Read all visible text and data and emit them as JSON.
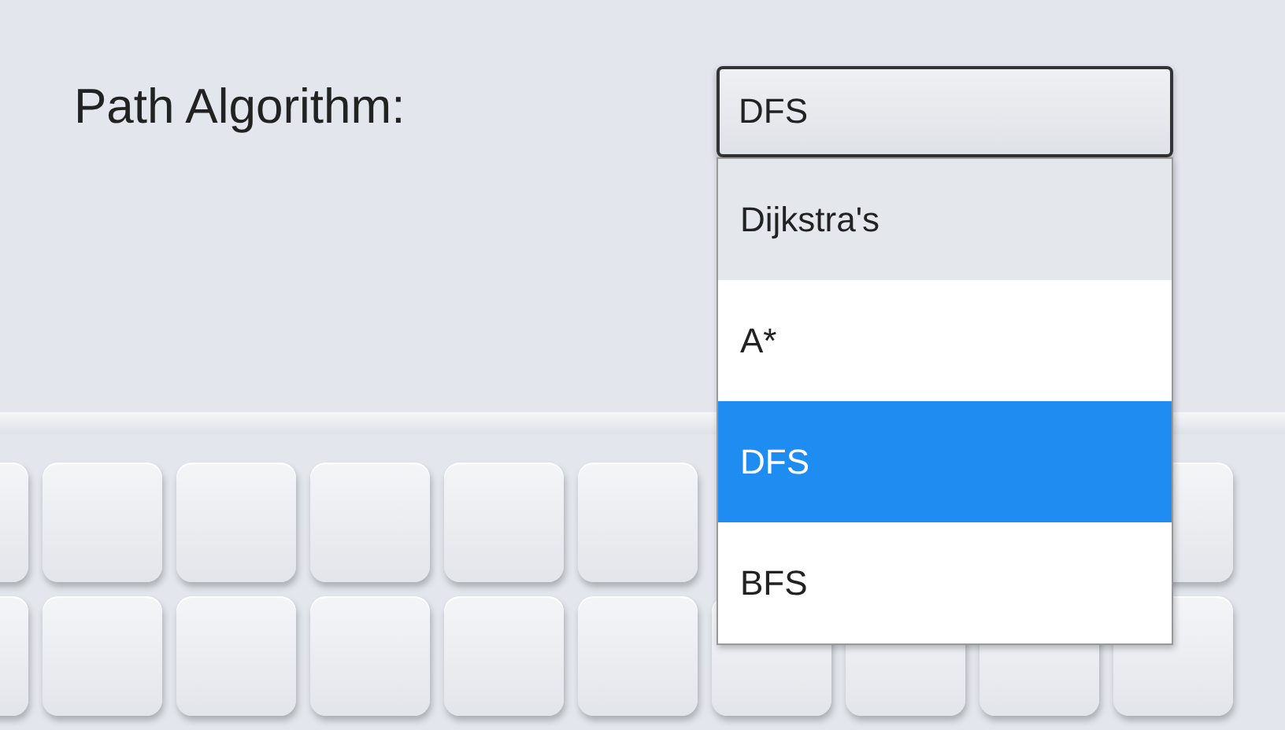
{
  "label": "Path Algorithm:",
  "select": {
    "value": "DFS",
    "expanded": true
  },
  "options": [
    {
      "label": "Dijkstra's",
      "selected": false,
      "hovered": true
    },
    {
      "label": "A*",
      "selected": false,
      "hovered": false
    },
    {
      "label": "DFS",
      "selected": true,
      "hovered": false
    },
    {
      "label": "BFS",
      "selected": false,
      "hovered": false
    }
  ]
}
